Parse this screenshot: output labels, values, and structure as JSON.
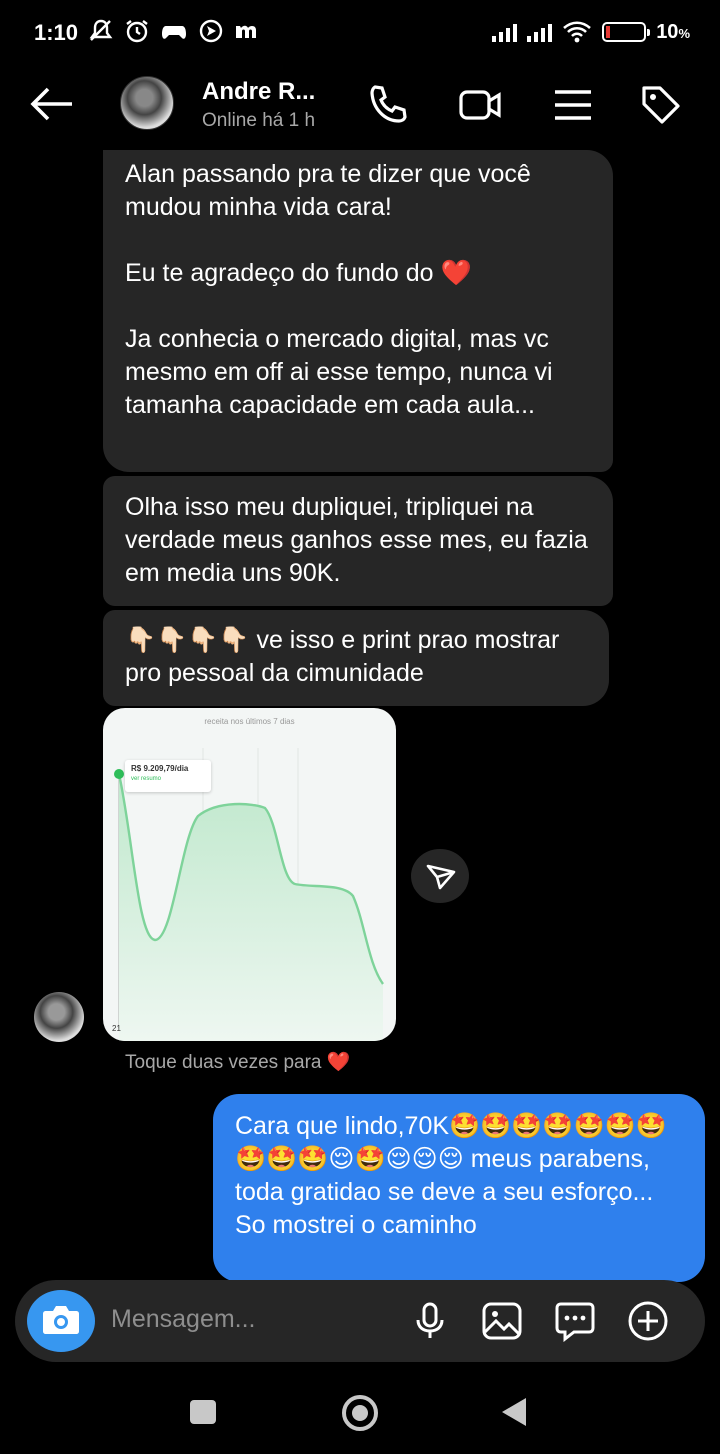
{
  "status_bar": {
    "time": "1:10",
    "left_icons": [
      "bell-off-icon",
      "alarm-icon",
      "game-controller-icon",
      "nav-app-icon",
      "m-app-icon"
    ],
    "battery": "10",
    "battery_unit": "%"
  },
  "header": {
    "contact_name": "Andre R...",
    "contact_status": "Online há 1 h",
    "icons": [
      "back-arrow-icon",
      "phone-icon",
      "video-icon",
      "menu-icon",
      "tag-icon"
    ]
  },
  "messages": {
    "msg1": {
      "p1": "Alan passando pra te dizer que você mudou minha vida cara!",
      "p2": "Eu te agradeço do fundo do ❤️",
      "p3": "Ja conhecia o mercado digital, mas vc mesmo em off ai esse tempo, nunca vi tamanha capacidade em cada aula..."
    },
    "msg2": "Olha isso meu dupliquei, tripliquei na verdade meus ganhos esse mes, eu fazia em media uns 90K.",
    "msg3": "👇🏻👇🏻👇🏻👇🏻 ve isso e print prao mostrar pro pessoal da cimunidade",
    "image": {
      "chart_title": "receita nos últimos 7 dias",
      "tooltip_value": "R$ 9.209,79/dia",
      "tooltip_link": "ver resumo",
      "x_label": "21"
    },
    "double_tap_hint": "Toque duas vezes para",
    "double_tap_heart": "❤️",
    "sent": "Cara que lindo,70K🤩🤩🤩🤩🤩🤩🤩🤩🤩🤩😌🤩😌😌😌 meus parabens, toda gratidao se deve a seu esforço... So mostrei o caminho"
  },
  "composer": {
    "placeholder": "Mensagem...",
    "icons": [
      "camera-icon",
      "microphone-icon",
      "gallery-icon",
      "sticker-icon",
      "plus-icon"
    ]
  },
  "colors": {
    "incoming_bubble": "#262626",
    "outgoing_bubble": "#2f80ed",
    "camera_button": "#3797f0",
    "chart_line": "#7ed39a"
  },
  "chart_data": {
    "type": "area",
    "title": "receita nos últimos 7 dias",
    "annotation": "R$ 9.209,79/dia",
    "x": [
      "21"
    ],
    "series": [
      {
        "values": []
      }
    ],
    "grid": true
  }
}
